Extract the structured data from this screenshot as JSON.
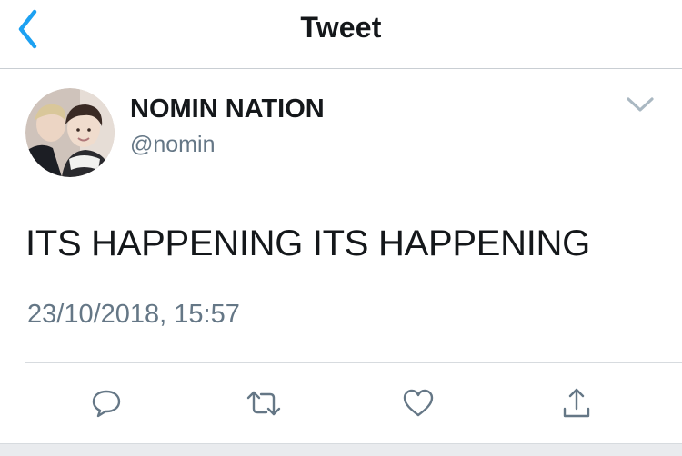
{
  "nav": {
    "title": "Tweet",
    "back_icon": "chevron-left-icon",
    "accent_color": "#1da1f2"
  },
  "tweet": {
    "author": {
      "display_name": "NOMIN NATION",
      "handle": "@nomin"
    },
    "text": "ITS HAPPENING ITS HAPPENING",
    "timestamp": "23/10/2018, 15:57",
    "menu_icon": "chevron-down-icon"
  },
  "actions": [
    {
      "name": "reply",
      "icon": "reply-icon"
    },
    {
      "name": "retweet",
      "icon": "retweet-icon"
    },
    {
      "name": "like",
      "icon": "heart-icon"
    },
    {
      "name": "share",
      "icon": "share-icon"
    }
  ]
}
